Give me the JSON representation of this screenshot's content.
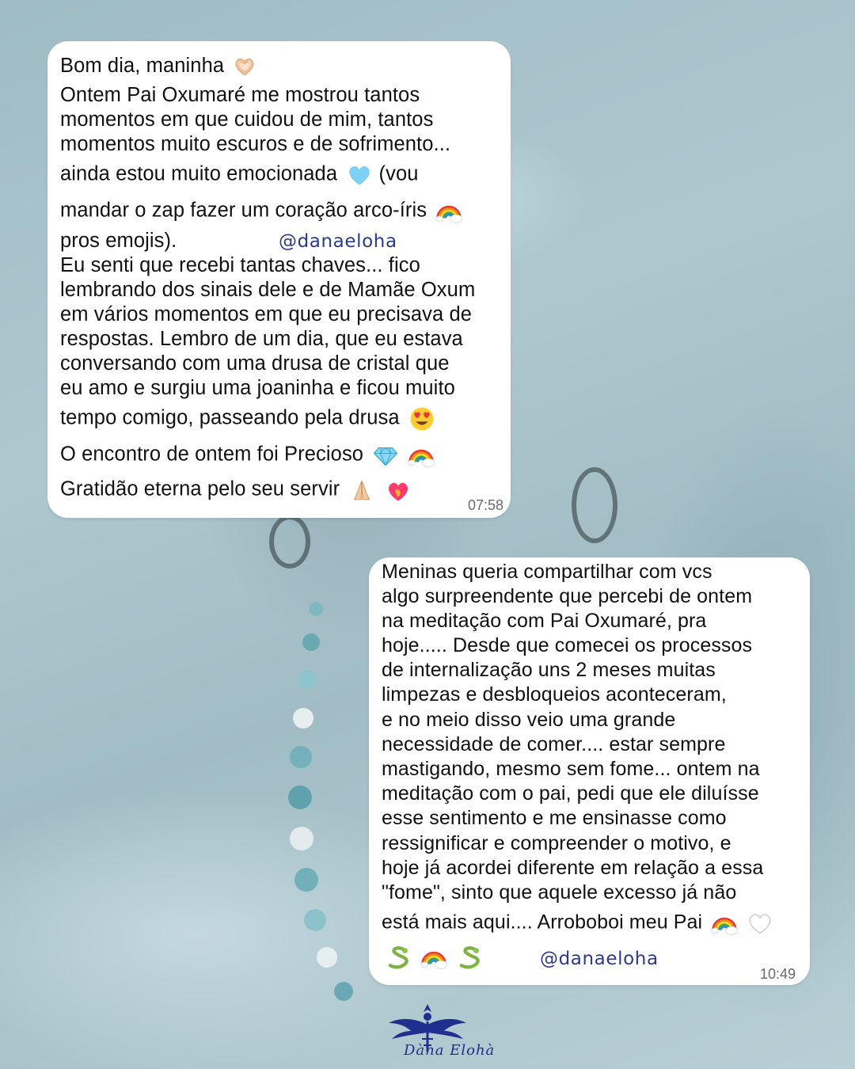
{
  "colors": {
    "bubble": "#ffffff",
    "handle": "#2d3a8c",
    "timestamp": "#6b6b6b",
    "logo": "#1e2f8e"
  },
  "message1": {
    "lines": [
      "Bom dia, maninha",
      "Ontem Pai Oxumaré me mostrou tantos",
      "momentos em que cuidou de mim, tantos",
      "momentos muito escuros e de sofrimento...",
      "ainda estou muito emocionada",
      "(vou",
      "mandar o zap fazer um coração arco-íris",
      "pros emojis).",
      "Eu senti que recebi tantas chaves... fico",
      "lembrando dos sinais dele e de Mamãe Oxum",
      "em vários momentos em que eu precisava de",
      "respostas. Lembro de um dia, que eu estava",
      "conversando com uma drusa de cristal que",
      "eu amo e surgiu uma joaninha e ficou muito",
      "tempo comigo, passeando pela drusa",
      "O encontro de ontem foi Precioso",
      "Gratidão eterna pelo seu servir"
    ],
    "handle": "@danaeloha",
    "time": "07:58"
  },
  "message2": {
    "lines": [
      "Meninas queria compartilhar com vcs",
      "algo surpreendente que percebi de ontem",
      "na meditação com Pai Oxumaré, pra",
      "hoje..... Desde que comecei os processos",
      "de internalização uns 2 meses muitas",
      "limpezas e desbloqueios aconteceram,",
      "e no meio disso veio uma grande",
      "necessidade de comer.... estar sempre",
      "mastigando, mesmo sem fome... ontem na",
      "meditação com o pai, pedi que ele diluísse",
      "esse sentimento e me ensinasse como",
      "ressignificar e compreender o motivo, e",
      "hoje já acordei diferente em relação a essa",
      "\"fome\", sinto que aquele excesso já não",
      "está mais aqui.... Arroboboi meu Pai"
    ],
    "handle": "@danaeloha",
    "time": "10:49"
  },
  "icons": [
    "heart-hands-icon",
    "light-blue-heart-icon",
    "rainbow-icon",
    "heart-eyes-icon",
    "gem-icon",
    "praying-hands-icon",
    "heart-on-fire-icon",
    "white-heart-icon",
    "snake-icon"
  ],
  "logo": {
    "text": "Dàna Elohà"
  }
}
